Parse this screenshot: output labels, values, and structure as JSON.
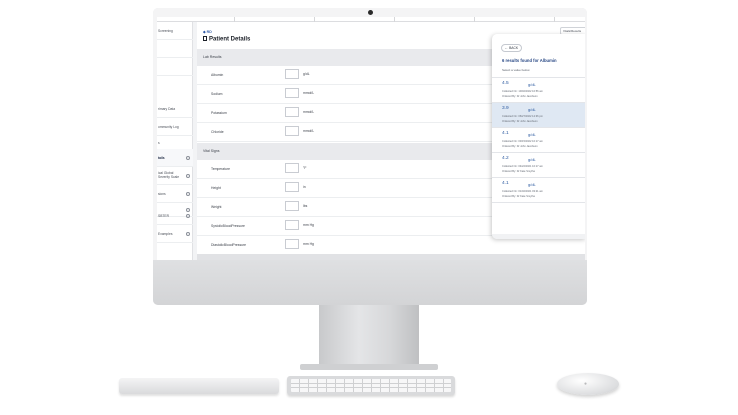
{
  "app": {
    "patient_link": "◆ RD",
    "page_title": "Patient Details",
    "top_right_button": "Vitals/Results"
  },
  "nav": {
    "items": [
      {
        "label": "Screening",
        "has_dot": false
      },
      {
        "label": "",
        "has_dot": false
      },
      {
        "label": "",
        "has_dot": false
      },
      {
        "label": "rimary Data",
        "has_dot": false
      },
      {
        "label": "ommunity Log",
        "has_dot": false
      },
      {
        "label": "s",
        "has_dot": false
      },
      {
        "label": "tails",
        "has_dot": true,
        "active": true
      },
      {
        "label": "ical Global Severity Scale",
        "has_dot": true
      },
      {
        "label": "sions",
        "has_dot": true
      },
      {
        "label": "",
        "has_dot": true
      },
      {
        "label": "SBTER",
        "has_dot": true
      },
      {
        "label": "Examples",
        "has_dot": true
      }
    ]
  },
  "sections": [
    {
      "title": "Lab Results",
      "rows": [
        {
          "label": "Albumin",
          "unit": "g/dL"
        },
        {
          "label": "Sodium",
          "unit": "mmol/L"
        },
        {
          "label": "Potassium",
          "unit": "mmol/L"
        },
        {
          "label": "Chloride",
          "unit": "mmol/L"
        }
      ]
    },
    {
      "title": "Vital Signs",
      "rows": [
        {
          "label": "Temperature",
          "unit": "°F"
        },
        {
          "label": "Height",
          "unit": "in"
        },
        {
          "label": "Weight",
          "unit": "lbs"
        },
        {
          "label": "SystolicBloodPressure",
          "unit": "mm Hg"
        },
        {
          "label": "DiastolicBloodPressure",
          "unit": "mm Hg"
        }
      ]
    }
  ],
  "results_panel": {
    "back_label": "BACK",
    "title": "6 results found for Albumin",
    "subtitle": "Select a value below",
    "results": [
      {
        "value": "4.5",
        "unit": "g/dL",
        "collected": "Collected On: 10/02/2022 10:56 am",
        "ordered": "Ordered By: Dr John Jacobson",
        "selected": false
      },
      {
        "value": "3.9",
        "unit": "g/dL",
        "collected": "Collected On: 06/27/2022 12:36 pm",
        "ordered": "Ordered By: Dr John Jacobson",
        "selected": true
      },
      {
        "value": "4.1",
        "unit": "g/dL",
        "collected": "Collected On: 03/15/2022 10:17 am",
        "ordered": "Ordered By: Dr John Jacobson",
        "selected": false
      },
      {
        "value": "4.2",
        "unit": "g/dL",
        "collected": "Collected On: 04/22/2021 10:17 am",
        "ordered": "Ordered By: Dr Kate Smythe",
        "selected": false
      },
      {
        "value": "4.1",
        "unit": "g/dL",
        "collected": "Collected On: 01/02/2021 03:21 am",
        "ordered": "Ordered By: Dr Kate Smythe",
        "selected": false
      }
    ]
  },
  "colors": {
    "accent": "#2c5aa0",
    "selected_row": "#dfe8f3",
    "section_header": "#e9eaed"
  },
  "icons": {
    "page_title": "document-icon",
    "back": "arrow-left-icon",
    "mouse_logo": "apple-logo-icon"
  }
}
